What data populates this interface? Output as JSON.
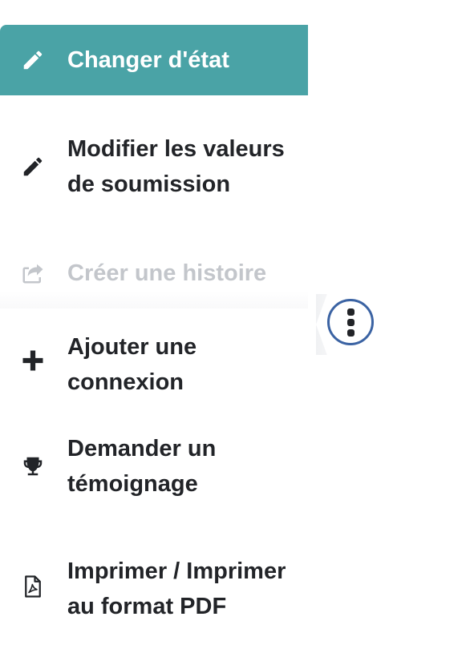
{
  "menu": {
    "items": [
      {
        "label": "Changer d'état",
        "icon": "pencil-icon",
        "state": "active"
      },
      {
        "label": "Modifier les valeurs de soumission",
        "icon": "pencil-icon",
        "state": "default"
      },
      {
        "label": "Créer une histoire",
        "icon": "share-icon",
        "state": "disabled"
      },
      {
        "label": "Ajouter une connexion",
        "icon": "plus-icon",
        "state": "default"
      },
      {
        "label": "Demander un témoignage",
        "icon": "trophy-icon",
        "state": "default"
      },
      {
        "label": "Imprimer / Imprimer au format PDF",
        "icon": "pdf-file-icon",
        "state": "default"
      }
    ]
  },
  "kebab": {
    "icon": "kebab-vertical-icon"
  },
  "colors": {
    "active_bg": "#4aa3a6",
    "text": "#222428",
    "disabled_text": "#c3c6cb",
    "kebab_ring": "#3b63a3"
  }
}
